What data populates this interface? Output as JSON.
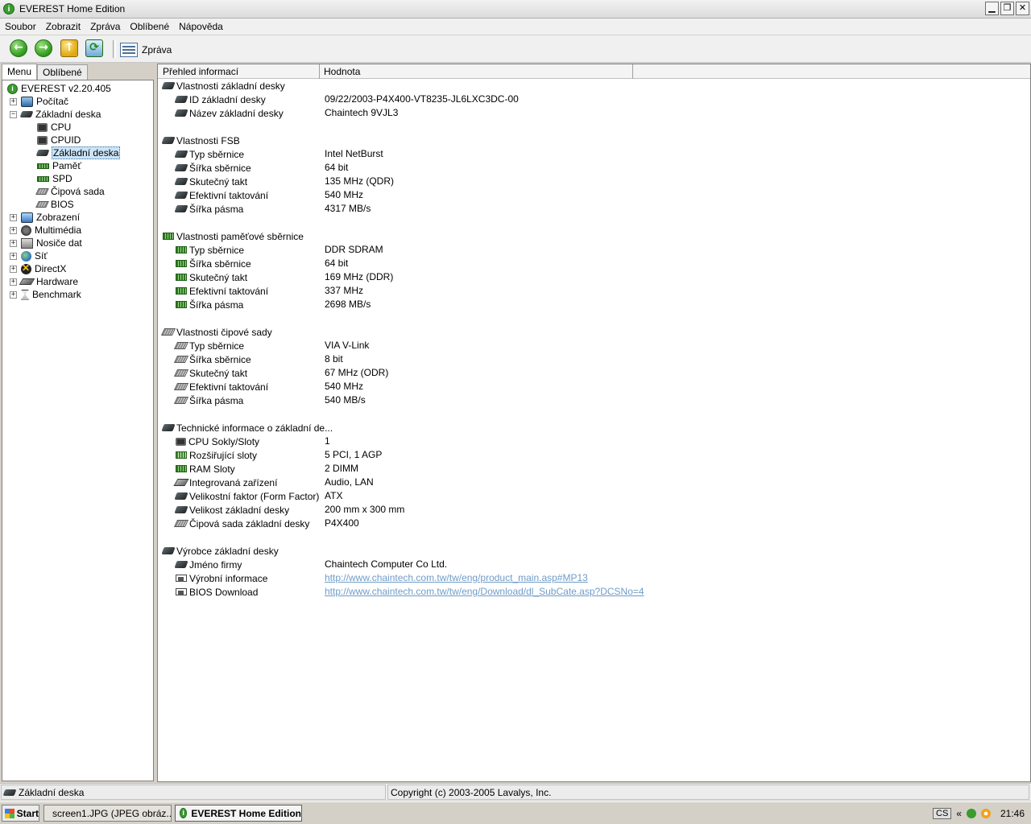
{
  "window": {
    "title": "EVEREST Home Edition"
  },
  "menu": [
    "Soubor",
    "Zobrazit",
    "Zpráva",
    "Oblíbené",
    "Nápověda"
  ],
  "toolbar": {
    "report_label": "Zpráva"
  },
  "tabs": {
    "menu": "Menu",
    "favorites": "Oblíbené"
  },
  "tree": {
    "root": "EVEREST v2.20.405",
    "items": [
      "Počítač",
      "Základní deska",
      "CPU",
      "CPUID",
      "Základní deska",
      "Paměť",
      "SPD",
      "Čipová sada",
      "BIOS",
      "Zobrazení",
      "Multimédia",
      "Nosiče dat",
      "Síť",
      "DirectX",
      "Hardware",
      "Benchmark"
    ]
  },
  "columns": {
    "field": "Přehled informací",
    "value": "Hodnota"
  },
  "sections": [
    {
      "title": "Vlastnosti základní desky",
      "rows": [
        {
          "label": "ID základní desky",
          "value": "09/22/2003-P4X400-VT8235-JL6LXC3DC-00"
        },
        {
          "label": "Název základní desky",
          "value": "Chaintech 9VJL3"
        }
      ]
    },
    {
      "title": "Vlastnosti FSB",
      "rows": [
        {
          "label": "Typ sběrnice",
          "value": "Intel NetBurst"
        },
        {
          "label": "Šířka sběrnice",
          "value": "64 bit"
        },
        {
          "label": "Skutečný takt",
          "value": "135 MHz (QDR)"
        },
        {
          "label": "Efektivní taktování",
          "value": "540 MHz"
        },
        {
          "label": "Šířka pásma",
          "value": "4317 MB/s"
        }
      ]
    },
    {
      "title": "Vlastnosti paměťové sběrnice",
      "rows": [
        {
          "label": "Typ sběrnice",
          "value": "DDR SDRAM"
        },
        {
          "label": "Šířka sběrnice",
          "value": "64 bit"
        },
        {
          "label": "Skutečný takt",
          "value": "169 MHz (DDR)"
        },
        {
          "label": "Efektivní taktování",
          "value": "337 MHz"
        },
        {
          "label": "Šířka pásma",
          "value": "2698 MB/s"
        }
      ]
    },
    {
      "title": "Vlastnosti čipové sady",
      "rows": [
        {
          "label": "Typ sběrnice",
          "value": "VIA V-Link"
        },
        {
          "label": "Šířka sběrnice",
          "value": "8 bit"
        },
        {
          "label": "Skutečný takt",
          "value": "67 MHz (ODR)"
        },
        {
          "label": "Efektivní taktování",
          "value": "540 MHz"
        },
        {
          "label": "Šířka pásma",
          "value": "540 MB/s"
        }
      ]
    },
    {
      "title": "Technické informace o základní de...",
      "rows": [
        {
          "label": "CPU Sokly/Sloty",
          "value": "1"
        },
        {
          "label": "Rozšiřující sloty",
          "value": "5 PCI, 1 AGP"
        },
        {
          "label": "RAM Sloty",
          "value": "2 DIMM"
        },
        {
          "label": "Integrovaná zařízení",
          "value": "Audio, LAN"
        },
        {
          "label": "Velikostní faktor (Form Factor)",
          "value": "ATX"
        },
        {
          "label": "Velikost základní desky",
          "value": "200 mm x 300 mm"
        },
        {
          "label": "Čipová sada základní desky",
          "value": "P4X400"
        }
      ]
    },
    {
      "title": "Výrobce základní desky",
      "rows": [
        {
          "label": "Jméno firmy",
          "value": "Chaintech Computer Co Ltd."
        },
        {
          "label": "Výrobní informace",
          "value": "http://www.chaintech.com.tw/tw/eng/product_main.asp#MP13"
        },
        {
          "label": "BIOS Download",
          "value": "http://www.chaintech.com.tw/tw/eng/Download/dl_SubCate.asp?DCSNo=4"
        }
      ]
    }
  ],
  "status": {
    "left": "Základní deska",
    "right": "Copyright (c) 2003-2005 Lavalys, Inc."
  },
  "taskbar": {
    "start": "Start",
    "tasks": [
      "screen1.JPG (JPEG obráz...",
      "EVEREST Home Edition"
    ],
    "lang": "CS",
    "clock": "21:46"
  }
}
